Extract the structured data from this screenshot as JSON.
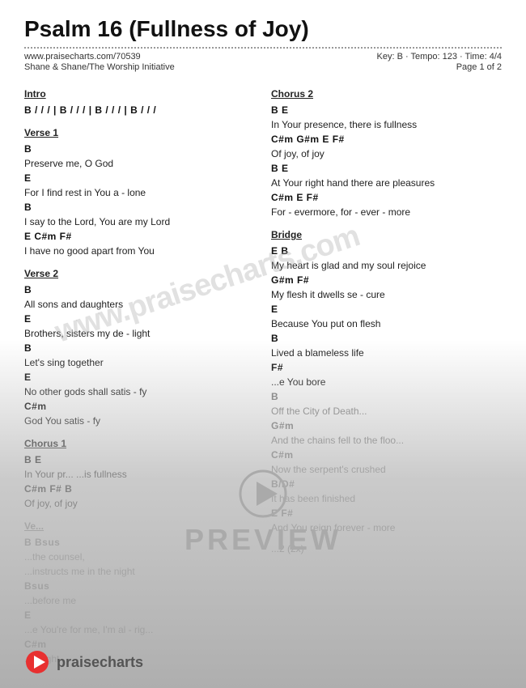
{
  "page": {
    "title": "Psalm 16 (Fullness of Joy)",
    "url": "www.praisecharts.com/70539",
    "artist": "Shane & Shane/The Worship Initiative",
    "key": "Key: B",
    "tempo": "Tempo: 123",
    "time": "Time: 4/4",
    "page_num": "Page 1 of 2"
  },
  "left_column": {
    "intro": {
      "label": "Intro",
      "line1": "B  /  /  /  |  B  /  /  /  |  B  /  /  /  |  B  /  /  /"
    },
    "verse1": {
      "label": "Verse 1",
      "lines": [
        {
          "chord": "B",
          "lyric": "  Preserve me, O God"
        },
        {
          "chord": "",
          "lyric": "For I find rest in You a - lone"
        },
        {
          "chord": "",
          "lyric": "        E"
        },
        {
          "chord": "B",
          "lyric": "  I say to the Lord, You are my Lord"
        },
        {
          "chord": "        E             C#m  F#",
          "lyric": ""
        },
        {
          "chord": "",
          "lyric": "I have no good apart from  You"
        }
      ]
    },
    "verse2": {
      "label": "Verse 2",
      "lines": [
        {
          "chord": "B",
          "lyric": ""
        },
        {
          "chord": "",
          "lyric": "  All sons and daughters"
        },
        {
          "chord": "",
          "lyric": "                    E"
        },
        {
          "chord": "",
          "lyric": "Brothers, sisters my de - light"
        },
        {
          "chord": "B",
          "lyric": ""
        },
        {
          "chord": "",
          "lyric": "Let's sing together"
        },
        {
          "chord": "                  E",
          "lyric": ""
        },
        {
          "chord": "",
          "lyric": "No other gods shall satis - fy"
        },
        {
          "chord": "          C#m",
          "lyric": ""
        },
        {
          "chord": "",
          "lyric": "God You satis - fy"
        }
      ]
    },
    "chorus1": {
      "label": "Chorus 1",
      "lines": [
        {
          "chord": "    B",
          "lyric": "              E"
        },
        {
          "chord": "",
          "lyric": "In Your presence, there is fullness"
        },
        {
          "chord": "    C#m",
          "lyric": "             F#   B"
        },
        {
          "chord": "",
          "lyric": "Of  joy,       of joy"
        }
      ]
    },
    "verse3": {
      "label": "Ve...",
      "lines": [
        {
          "chord": "B",
          "lyric": ""
        },
        {
          "chord": "",
          "lyric": "...the counsel,"
        },
        {
          "chord": "         Bsus",
          "lyric": ""
        },
        {
          "chord": "",
          "lyric": "...instructs me in the night"
        },
        {
          "chord": "         Bsus",
          "lyric": ""
        },
        {
          "chord": "",
          "lyric": "...before me"
        },
        {
          "chord": "",
          "lyric": "                           E"
        },
        {
          "chord": "",
          "lyric": "...e You're for me, I'm al - rig..."
        },
        {
          "chord": "       C#m",
          "lyric": ""
        },
        {
          "chord": "",
          "lyric": "...e right"
        }
      ]
    }
  },
  "right_column": {
    "chorus2": {
      "label": "Chorus 2",
      "lines": [
        {
          "chord": "    B",
          "lyric": "              E"
        },
        {
          "chord": "",
          "lyric": "In Your presence, there is fullness"
        },
        {
          "chord": "  C#m  G#m   E    F#",
          "lyric": ""
        },
        {
          "chord": "",
          "lyric": "Of joy,      of joy"
        },
        {
          "chord": "    B",
          "lyric": "              E"
        },
        {
          "chord": "",
          "lyric": "At Your right hand there are pleasures"
        },
        {
          "chord": "      C#m        E    F#",
          "lyric": ""
        },
        {
          "chord": "",
          "lyric": "For - evermore, for - ever - more"
        }
      ]
    },
    "bridge": {
      "label": "Bridge",
      "lines": [
        {
          "chord": "    E",
          "lyric": "              B"
        },
        {
          "chord": "",
          "lyric": "My heart is glad and my soul rejoice"
        },
        {
          "chord": "   G#m",
          "lyric": "          F#"
        },
        {
          "chord": "",
          "lyric": "My flesh it dwells se - cure"
        },
        {
          "chord": "   E",
          "lyric": ""
        },
        {
          "chord": "",
          "lyric": "Because You put on flesh"
        },
        {
          "chord": "    B",
          "lyric": ""
        },
        {
          "chord": "",
          "lyric": "Lived a blameless life"
        },
        {
          "chord": "                       F#",
          "lyric": ""
        },
        {
          "chord": "",
          "lyric": "...e You bore"
        },
        {
          "chord": "    B",
          "lyric": ""
        },
        {
          "chord": "",
          "lyric": "Off the City of Death..."
        },
        {
          "chord": "  G#m",
          "lyric": ""
        },
        {
          "chord": "",
          "lyric": "And the chains fell to the floo..."
        },
        {
          "chord": "   C#m",
          "lyric": ""
        },
        {
          "chord": "",
          "lyric": "Now the serpent's crushed"
        },
        {
          "chord": "   B/D#",
          "lyric": ""
        },
        {
          "chord": "",
          "lyric": "It has been finished"
        },
        {
          "chord": "    E",
          "lyric": "              F#"
        },
        {
          "chord": "",
          "lyric": "And You reign forever - more"
        }
      ]
    },
    "tag": {
      "lines": [
        {
          "chord": "",
          "lyric": "...2 (2x)"
        }
      ]
    }
  },
  "preview": {
    "watermark_text": "www.praisecharts.com",
    "preview_label": "PREVIEW",
    "footer_brand": "praisecharts"
  },
  "footer": {
    "brand": "praisecharts"
  }
}
